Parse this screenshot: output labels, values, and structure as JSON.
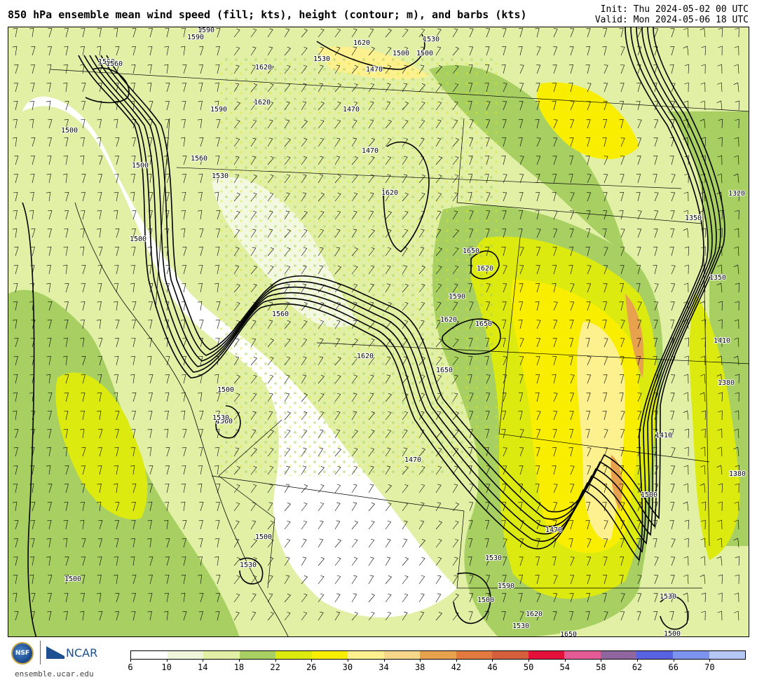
{
  "header": {
    "title": "850 hPa ensemble mean wind speed (fill; kts), height (contour; m), and barbs (kts)",
    "init": "Init: Thu 2024-05-02 00 UTC",
    "valid": "Valid: Mon 2024-05-06 18 UTC"
  },
  "colors": {
    "ocean_calm": "#f3f8e1",
    "speed_10": "#f1f6dd",
    "speed_14": "#e2f0a6",
    "speed_18": "#a7cf62",
    "speed_22": "#dcea0f",
    "speed_26": "#f9ee00",
    "speed_30": "#fdf08f",
    "speed_34": "#f7d78a",
    "speed_38": "#e8a24e",
    "contour": "#000000"
  },
  "contour_labels": [
    "1560",
    "1590",
    "1620",
    "1620",
    "1500",
    "1500",
    "1590",
    "1530",
    "1560",
    "1500",
    "1590",
    "1560",
    "1620",
    "1530",
    "1470",
    "1500",
    "1530",
    "1470",
    "1470",
    "1620",
    "1650",
    "1620",
    "1590",
    "1620",
    "1650",
    "1560",
    "1620",
    "1650",
    "1500",
    "1560",
    "1530",
    "1470",
    "1500",
    "1530",
    "1500",
    "1470",
    "1590",
    "1500",
    "1530",
    "1620",
    "1650",
    "1500",
    "1530",
    "1320",
    "1350",
    "1350",
    "1410",
    "1380",
    "1410",
    "1410",
    "1500",
    "1380",
    "1530",
    "1500"
  ],
  "footer": {
    "nsf": "NSF",
    "ncar": "NCAR",
    "site": "ensemble.ucar.edu"
  },
  "colorbar": {
    "ticks": [
      "6",
      "10",
      "14",
      "18",
      "22",
      "26",
      "30",
      "34",
      "38",
      "42",
      "46",
      "50",
      "54",
      "58",
      "62",
      "66",
      "70"
    ],
    "colors": [
      "#ffffff",
      "#eef5d8",
      "#e2f0a6",
      "#a7cf62",
      "#dcea0f",
      "#f9ee00",
      "#fdf08f",
      "#f7d78a",
      "#e8a24e",
      "#e27a3f",
      "#d45f3a",
      "#e4123b",
      "#e35a95",
      "#8f669e",
      "#5863e4",
      "#7c94f0",
      "#b4c7f5"
    ]
  }
}
